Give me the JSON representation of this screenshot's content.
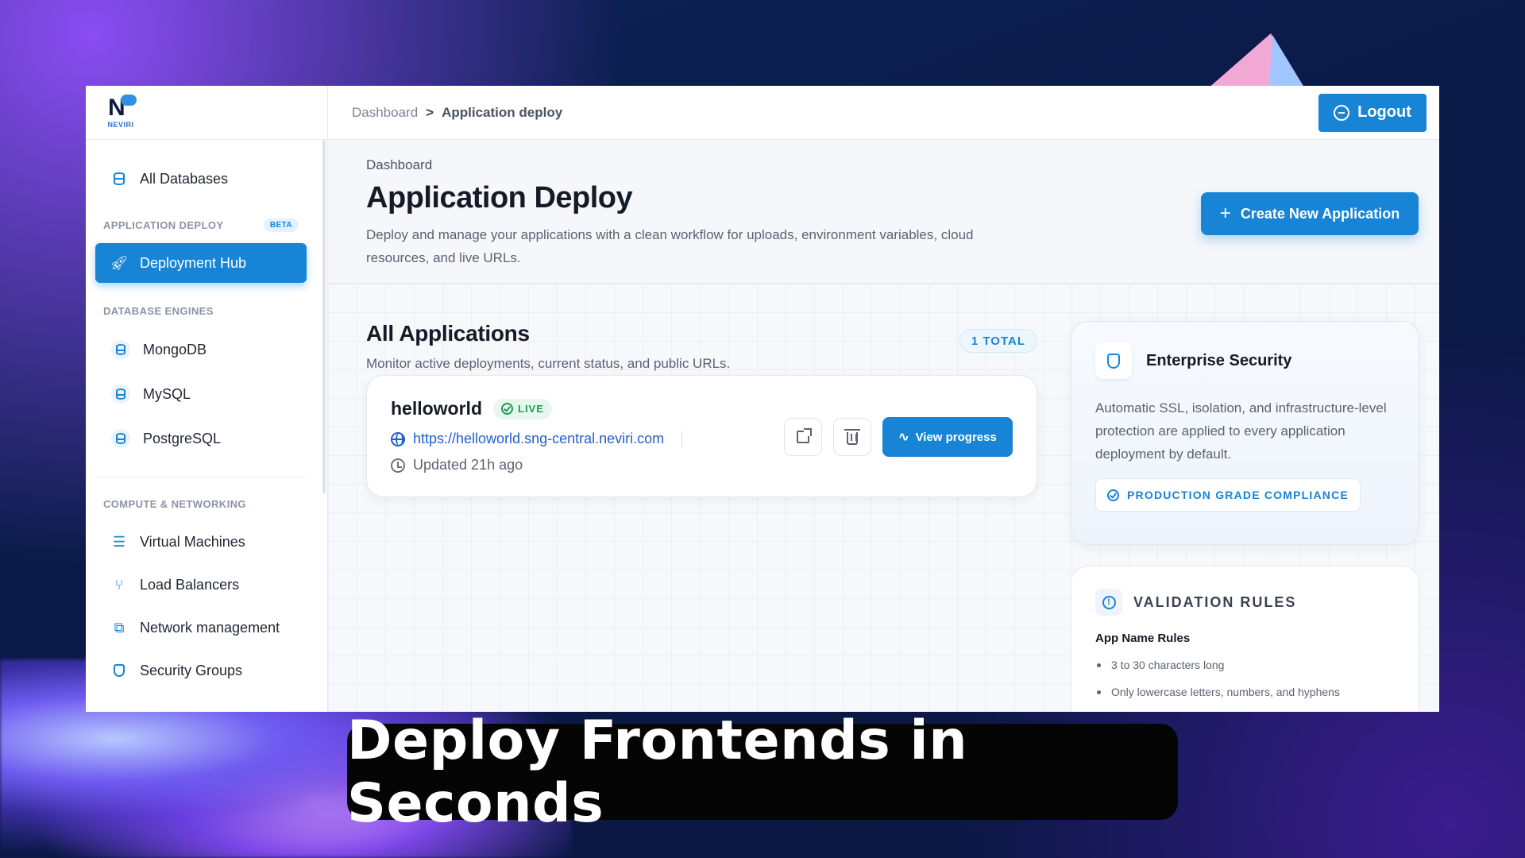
{
  "brand": {
    "logo_text": "NEVIRI",
    "accent": "#1784d6"
  },
  "topbar": {
    "breadcrumb": [
      "Dashboard",
      ">",
      "Application deploy"
    ],
    "logout_label": "Logout"
  },
  "sidebar": {
    "all_databases": "All Databases",
    "section_app_deploy": "APPLICATION DEPLOY",
    "beta_badge": "BETA",
    "deployment_hub": "Deployment Hub",
    "section_db_engines": "DATABASE ENGINES",
    "db_engines": [
      "MongoDB",
      "MySQL",
      "PostgreSQL"
    ],
    "section_compute": "COMPUTE & NETWORKING",
    "compute_items": [
      "Virtual Machines",
      "Load Balancers",
      "Network management",
      "Security Groups"
    ]
  },
  "header": {
    "eyebrow": "Dashboard",
    "title": "Application Deploy",
    "description": "Deploy and manage your applications with a clean workflow for uploads, environment variables, cloud resources, and live URLs.",
    "create_button": "Create New Application"
  },
  "applications": {
    "title": "All Applications",
    "subtitle": "Monitor active deployments, current status, and public URLs.",
    "total_badge": "1 TOTAL",
    "items": [
      {
        "name": "helloworld",
        "status": "LIVE",
        "url": "https://helloworld.sng-central.neviri.com",
        "updated": "Updated 21h ago",
        "view_button": "View progress"
      }
    ]
  },
  "security_card": {
    "title": "Enterprise Security",
    "description": "Automatic SSL, isolation, and infrastructure-level protection are applied to every application deployment by default.",
    "badge": "PRODUCTION GRADE COMPLIANCE"
  },
  "rules_card": {
    "title": "VALIDATION RULES",
    "subtitle": "App Name Rules",
    "rules": [
      "3 to 30 characters long",
      "Only lowercase letters, numbers, and hyphens"
    ]
  },
  "caption": "Deploy Frontends in Seconds"
}
